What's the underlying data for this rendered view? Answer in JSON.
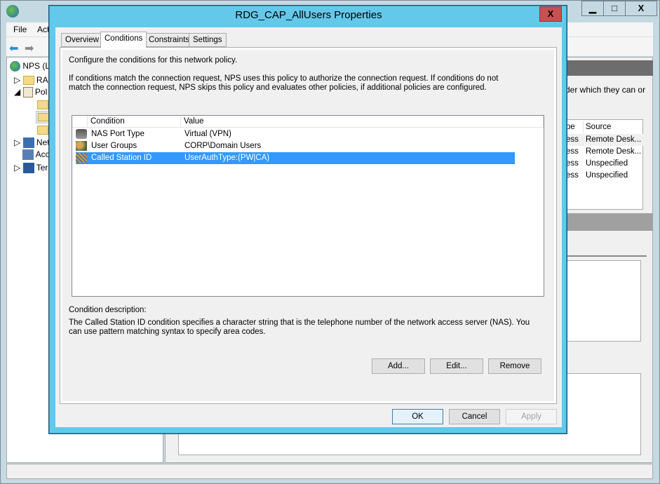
{
  "main_window": {
    "menu": [
      "File",
      "Act"
    ],
    "tree": [
      {
        "label": "NPS (L",
        "icon": "globe-icon"
      },
      {
        "label": "RAI",
        "icon": "folder-icon"
      },
      {
        "label": "Pol",
        "icon": "policy-scroll-icon"
      },
      {
        "label": "",
        "icon": "folder-icon"
      },
      {
        "label": "",
        "icon": "folder-open-icon"
      },
      {
        "label": "",
        "icon": "folder-icon"
      },
      {
        "label": "Net",
        "icon": "network-computer-icon"
      },
      {
        "label": "Acc",
        "icon": "accounting-icon"
      },
      {
        "label": "Ter",
        "icon": "terminal-computer-icon"
      }
    ],
    "right_text": "der which they can or",
    "table": {
      "headers": [
        "pe",
        "Source"
      ],
      "rows": [
        [
          "ess",
          "Remote Desk..."
        ],
        [
          "ess",
          "Remote Desk..."
        ],
        [
          "ess",
          "Unspecified"
        ],
        [
          "ess",
          "Unspecified"
        ]
      ]
    },
    "controls": {
      "minimize": "▁",
      "maximize": "□",
      "close": "X"
    }
  },
  "dialog": {
    "title": "RDG_CAP_AllUsers Properties",
    "close": "X",
    "tabs": [
      "Overview",
      "Conditions",
      "Constraints",
      "Settings"
    ],
    "active_tab": "Conditions",
    "intro": "Configure the conditions for this network policy.",
    "explanation": "If conditions match the connection request, NPS uses this policy to authorize the connection request. If conditions do not match the connection request, NPS skips this policy and evaluates other policies, if additional policies are configured.",
    "columns": [
      "Condition",
      "Value"
    ],
    "conditions": [
      {
        "condition": "NAS Port Type",
        "value": "Virtual (VPN)",
        "icon": "nas-port-icon"
      },
      {
        "condition": "User Groups",
        "value": "CORP\\Domain Users",
        "icon": "user-groups-icon"
      },
      {
        "condition": "Called Station ID",
        "value": "UserAuthType:(PW|CA)",
        "icon": "called-station-icon",
        "selected": true
      }
    ],
    "description_label": "Condition description:",
    "description": "The Called Station ID condition specifies a character string that is the telephone number of the network access server (NAS). You can use pattern matching syntax to specify area codes.",
    "buttons": {
      "add": "Add...",
      "edit": "Edit...",
      "remove": "Remove",
      "ok": "OK",
      "cancel": "Cancel",
      "apply": "Apply"
    },
    "colors": {
      "titlebar": "#63c8ea",
      "selection": "#3399ff",
      "close": "#c75050"
    }
  }
}
